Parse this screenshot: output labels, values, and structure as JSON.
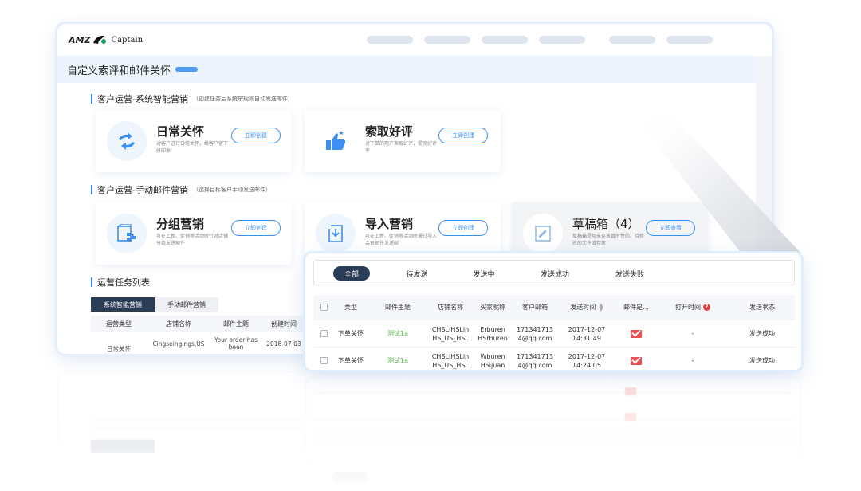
{
  "brand": {
    "logo_left": "AMZ",
    "logo_right": "Captain"
  },
  "page_title": "自定义索评和邮件关怀",
  "sections": {
    "auto": {
      "title": "客户运营-系统智能营销",
      "note": "（创建任务后系统按规则自动发送邮件）"
    },
    "manual": {
      "title": "客户运营-手动邮件营销",
      "note": "（选择目标客户手动发送邮件）"
    },
    "list": {
      "title": "运营任务列表"
    }
  },
  "cards": [
    {
      "title": "日常关怀",
      "desc": "对客户进行日常关怀，给客户留下好印象",
      "button": "立即创建",
      "icon": "refresh-arrows-icon"
    },
    {
      "title": "索取好评",
      "desc": "对下单的用户索取好评，提高好评率",
      "button": "立即创建",
      "icon": "thumbs-up-icon"
    },
    {
      "title": "分组营销",
      "desc": "可在上新、促销等活动时针对店铺分组发送邮件",
      "button": "立即创建",
      "icon": "group-docs-icon"
    },
    {
      "title": "导入营销",
      "desc": "可在上新、促销等活动时通过导入会员邮件发送邮",
      "button": "立即创建",
      "icon": "import-icon"
    },
    {
      "title": "草稿箱（4）",
      "desc": "草稿箱是用来存放暂时性的、待修改的文件或存放",
      "button": "立即查看",
      "icon": "draft-icon"
    }
  ],
  "back_table": {
    "tabs": [
      "系统智能营销",
      "手动邮件营销"
    ],
    "columns": [
      "运营类型",
      "店铺名称",
      "邮件主题",
      "创建时间"
    ],
    "row": [
      "日常关怀",
      "Cingseingings,US",
      "Your order has been",
      "2018-07-03"
    ]
  },
  "panel": {
    "tabs": [
      "全部",
      "待发送",
      "发送中",
      "发送成功",
      "发送失败"
    ],
    "columns": [
      "类型",
      "邮件主题",
      "店铺名称",
      "买家昵称",
      "客户邮箱",
      "发送时间",
      "邮件是...",
      "打开时间",
      "发送状态"
    ],
    "rows": [
      {
        "type": "下单关怀",
        "subject": "测试1a",
        "store": "CHSLIHSLin HS_US_HSL",
        "buyer": "Erburen HSrburen",
        "email": "171341713 4@qq.com",
        "sent": "2017-12-07 14:31:49",
        "opened": "-",
        "status": "发送成功"
      },
      {
        "type": "下单关怀",
        "subject": "测试1a",
        "store": "CHSLIHSLin HS_US_HSL",
        "buyer": "Wburen HSijuan",
        "email": "171341713 4@qq.com",
        "sent": "2017-12-07 14:24:05",
        "opened": "-",
        "status": "发送成功"
      }
    ]
  },
  "colors": {
    "accent": "#3d8ef2",
    "dark_tab": "#2b3c57",
    "mail_red": "#ee4e50",
    "link_green": "#58b04c"
  }
}
